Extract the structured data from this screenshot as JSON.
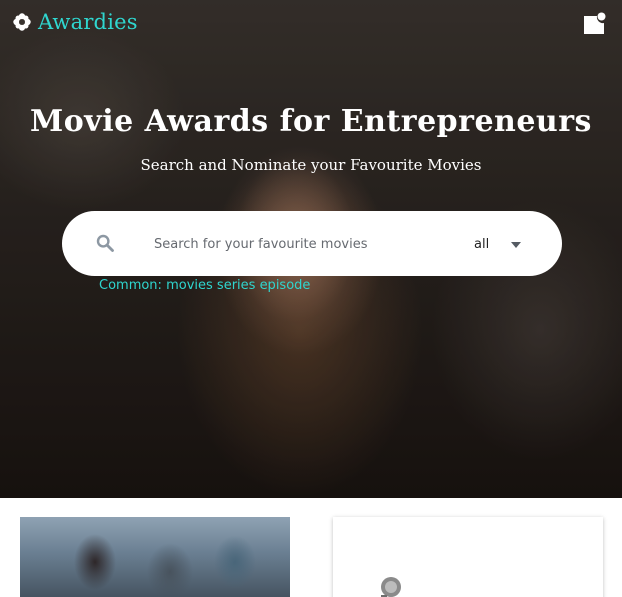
{
  "header": {
    "brand_name": "Awardies",
    "logo_icon": "flower-logo-icon",
    "notification_icon": "notification-bell-icon",
    "accent_color": "#2fd6cf"
  },
  "hero": {
    "title": "Movie Awards for Entrepreneurs",
    "subtitle": "Search and Nominate your Favourite Movies"
  },
  "search": {
    "placeholder": "Search for your favourite movies",
    "value": "",
    "category_selected": "all",
    "common_label": "Common:",
    "common_terms": [
      "movies",
      "series",
      "episode"
    ]
  },
  "cards": [
    {
      "kind": "poster",
      "icon": "movie-poster-image"
    },
    {
      "kind": "placeholder",
      "icon": "image-placeholder-icon"
    }
  ]
}
